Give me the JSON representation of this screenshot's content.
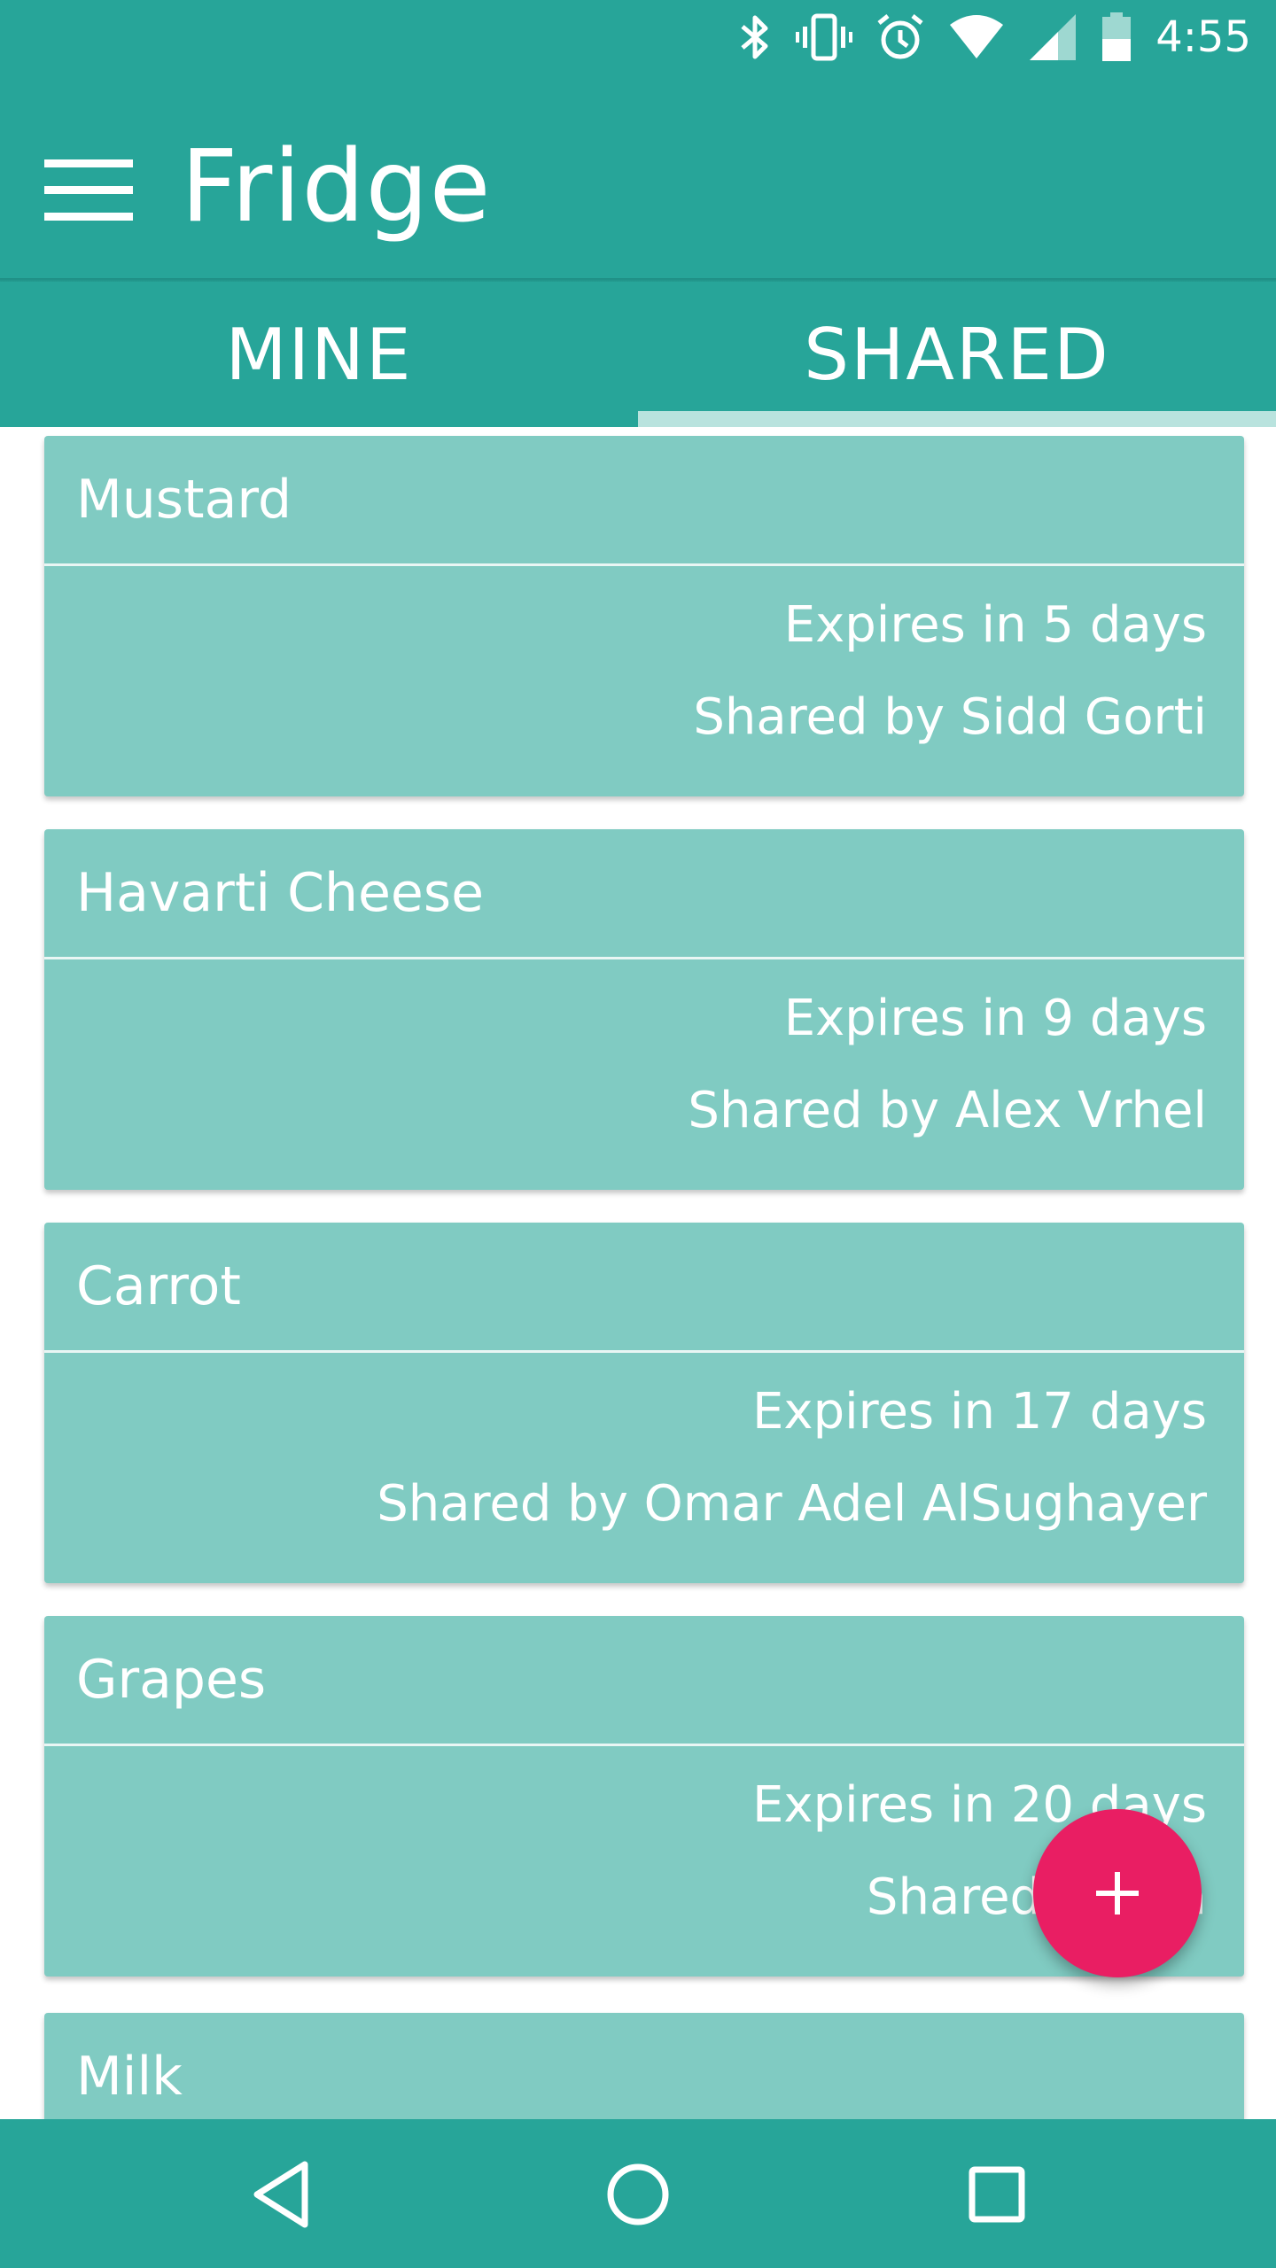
{
  "status_bar": {
    "time": "4:55",
    "icons": [
      "bluetooth-icon",
      "vibrate-icon",
      "alarm-icon",
      "wifi-icon",
      "signal-icon",
      "battery-icon"
    ]
  },
  "app_bar": {
    "title": "Fridge",
    "menu_icon": "menu-icon"
  },
  "tabs": [
    {
      "label": "MINE",
      "selected": false
    },
    {
      "label": "SHARED",
      "selected": true
    }
  ],
  "items": [
    {
      "name": "Mustard",
      "expiry": "Expires in 5 days",
      "shared_by": "Shared by Sidd Gorti"
    },
    {
      "name": "Havarti Cheese",
      "expiry": "Expires in 9 days",
      "shared_by": "Shared by Alex Vrhel"
    },
    {
      "name": "Carrot",
      "expiry": "Expires in 17 days",
      "shared_by": "Shared by Omar Adel AlSughayer"
    },
    {
      "name": "Grapes",
      "expiry": "Expires in 20 days",
      "shared_by": "Shared by Ma"
    },
    {
      "name": "Milk"
    }
  ],
  "fab": {
    "icon": "plus-icon"
  },
  "nav_bar": {
    "icons": [
      "back-icon",
      "home-icon",
      "recents-icon"
    ]
  },
  "colors": {
    "primary": "#27a599",
    "card": "#80cbc2",
    "accent": "#e91e63",
    "tab_indicator": "#b9e3de"
  }
}
